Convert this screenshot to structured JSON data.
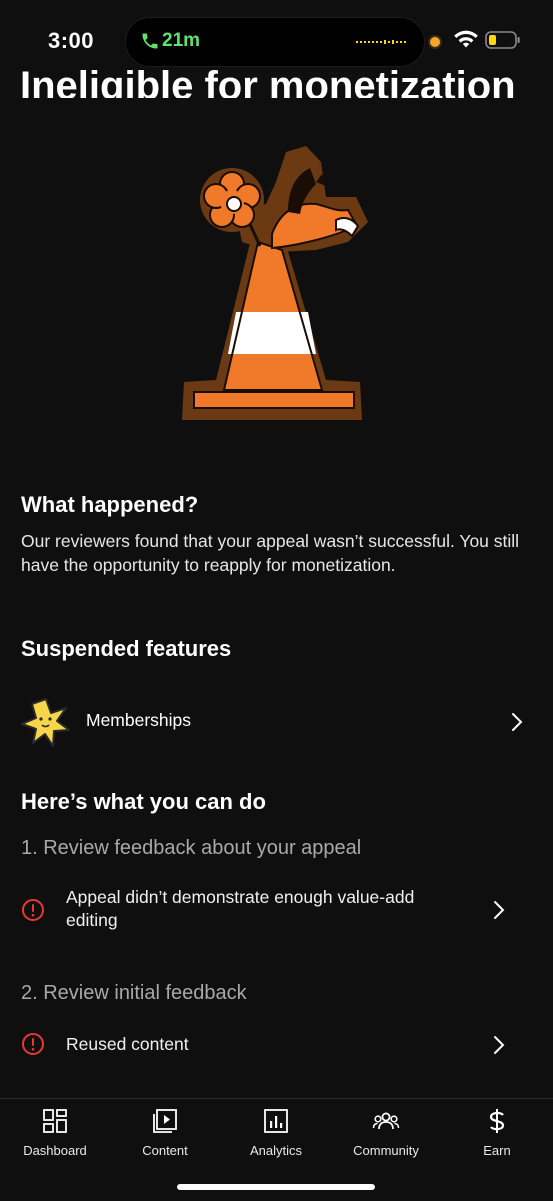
{
  "status_bar": {
    "time": "3:00",
    "call_duration": "21m",
    "call_color": "#5ee36b",
    "indicator_color": "#f7a52a",
    "battery_color": "#ffd60a"
  },
  "header": {
    "title": "Ineligible for monetization"
  },
  "what_happened": {
    "heading": "What happened?",
    "body": "Our reviewers found that your appeal wasn’t successful. You still have the opportunity to reapply for monetization."
  },
  "suspended": {
    "heading": "Suspended features",
    "items": [
      {
        "label": "Memberships",
        "icon": "star-badge-icon"
      }
    ]
  },
  "what_you_can_do": {
    "heading": "Here’s what you can do",
    "steps": [
      {
        "title": "1. Review feedback about your appeal",
        "items": [
          {
            "text": "Appeal didn’t demonstrate enough value-add editing",
            "icon": "alert-circle-icon"
          }
        ]
      },
      {
        "title": "2. Review initial feedback",
        "items": [
          {
            "text": "Reused content",
            "icon": "alert-circle-icon"
          }
        ]
      }
    ]
  },
  "bottom_nav": {
    "items": [
      {
        "label": "Dashboard",
        "icon": "dashboard-icon"
      },
      {
        "label": "Content",
        "icon": "content-icon"
      },
      {
        "label": "Analytics",
        "icon": "analytics-icon"
      },
      {
        "label": "Community",
        "icon": "community-icon"
      },
      {
        "label": "Earn",
        "icon": "dollar-icon"
      }
    ]
  },
  "colors": {
    "background": "#0f0f0f",
    "alert": "#e53935",
    "cone_orange": "#f07a2a",
    "cone_outline": "#6b3a12"
  }
}
